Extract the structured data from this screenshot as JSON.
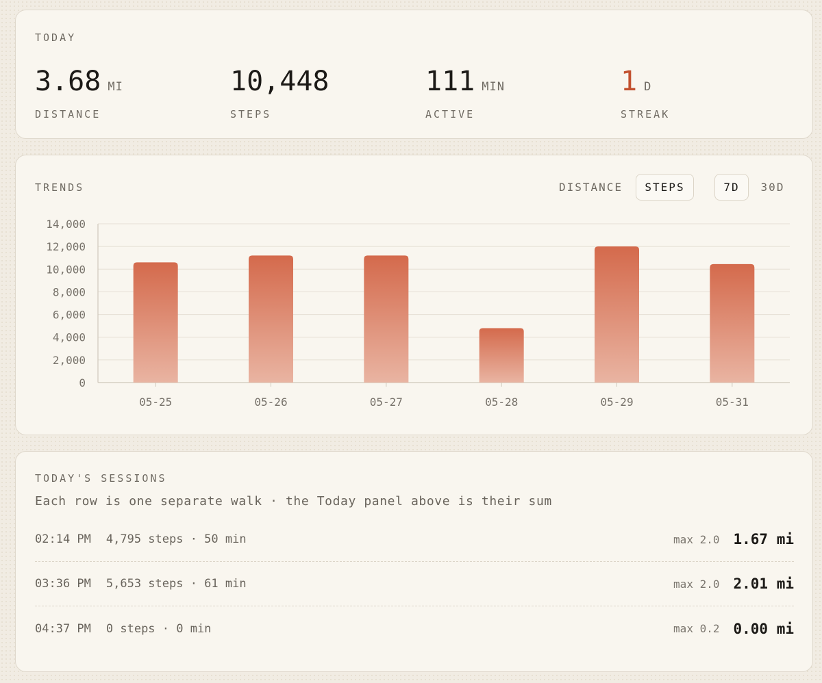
{
  "today": {
    "title": "TODAY",
    "stats": [
      {
        "value": "3.68",
        "unit": "MI",
        "label": "DISTANCE"
      },
      {
        "value": "10,448",
        "unit": "",
        "label": "STEPS"
      },
      {
        "value": "111",
        "unit": "MIN",
        "label": "ACTIVE"
      },
      {
        "value": "1",
        "unit": "D",
        "label": "STREAK"
      }
    ]
  },
  "trends": {
    "title": "TRENDS",
    "metric_toggle": {
      "distance": "DISTANCE",
      "steps": "STEPS",
      "selected": "STEPS"
    },
    "range_toggle": {
      "d7": "7D",
      "d30": "30D",
      "selected": "7D"
    }
  },
  "chart_data": {
    "type": "bar",
    "categories": [
      "05-25",
      "05-26",
      "05-27",
      "05-28",
      "05-29",
      "05-31"
    ],
    "values": [
      10600,
      11200,
      11200,
      4800,
      12000,
      10448
    ],
    "ylim": [
      0,
      14000
    ],
    "yticks": [
      0,
      2000,
      4000,
      6000,
      8000,
      10000,
      12000,
      14000
    ],
    "ytick_labels": [
      "0",
      "2,000",
      "4,000",
      "6,000",
      "8,000",
      "10,000",
      "12,000",
      "14,000"
    ],
    "grid": true,
    "colors": {
      "bar_top": "#d46a4c",
      "bar_bottom": "#e9b4a2",
      "grid": "#e5dfd4",
      "axis": "#cfc8bb"
    }
  },
  "sessions": {
    "title": "TODAY'S SESSIONS",
    "subtitle": "Each row is one separate walk · the Today panel above is their sum",
    "rows": [
      {
        "time": "02:14 PM",
        "summary": "4,795 steps · 50 min",
        "max": "max 2.0",
        "distance": "1.67 mi"
      },
      {
        "time": "03:36 PM",
        "summary": "5,653 steps · 61 min",
        "max": "max 2.0",
        "distance": "2.01 mi"
      },
      {
        "time": "04:37 PM",
        "summary": "0 steps · 0 min",
        "max": "max 0.2",
        "distance": "0.00 mi"
      }
    ]
  },
  "colors": {
    "accent": "#c2502e",
    "card_bg": "#f9f6ef",
    "page_bg": "#f1ece3"
  }
}
